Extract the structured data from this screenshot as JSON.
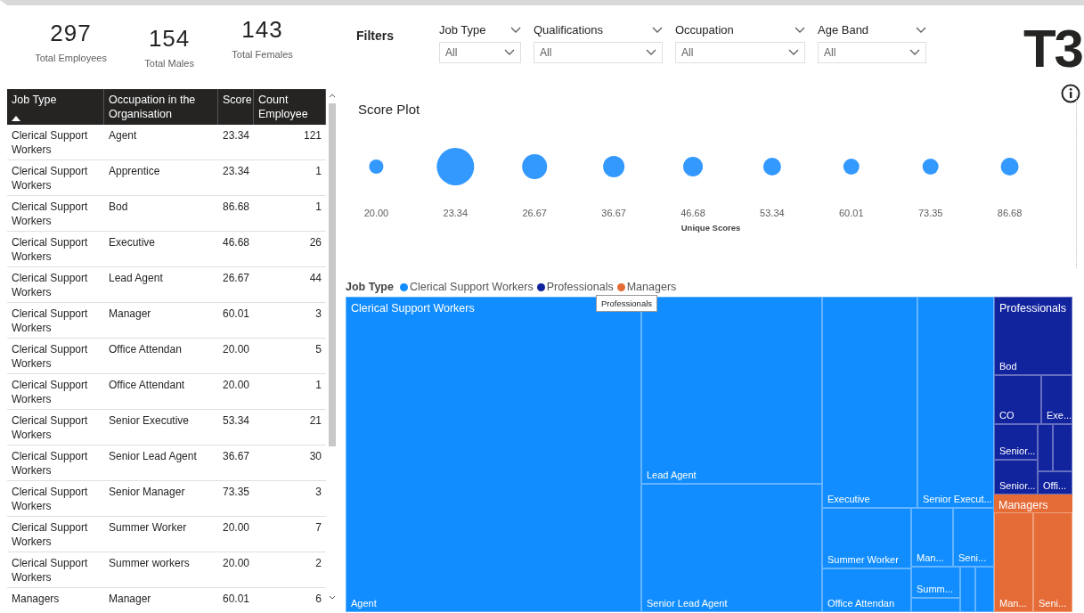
{
  "kpis": [
    {
      "value": "297",
      "label": "Total Employees"
    },
    {
      "value": "154",
      "label": "Total Males"
    },
    {
      "value": "143",
      "label": "Total Females"
    }
  ],
  "table": {
    "columns": [
      {
        "label": "Job Type",
        "sorted": true
      },
      {
        "label": "Occupation in the Organisation",
        "sorted": false
      },
      {
        "label": "Score",
        "sorted": false
      },
      {
        "label": "Count Employee",
        "sorted": false
      }
    ],
    "rows": [
      [
        "Clerical Support Workers",
        "Agent",
        "23.34",
        "121"
      ],
      [
        "Clerical Support Workers",
        "Apprentice",
        "23.34",
        "1"
      ],
      [
        "Clerical Support Workers",
        "Bod",
        "86.68",
        "1"
      ],
      [
        "Clerical Support Workers",
        "Executive",
        "46.68",
        "26"
      ],
      [
        "Clerical Support Workers",
        "Lead Agent",
        "26.67",
        "44"
      ],
      [
        "Clerical Support Workers",
        "Manager",
        "60.01",
        "3"
      ],
      [
        "Clerical Support Workers",
        "Office Attendan",
        "20.00",
        "5"
      ],
      [
        "Clerical Support Workers",
        "Office Attendant",
        "20.00",
        "1"
      ],
      [
        "Clerical Support Workers",
        "Senior Executive",
        "53.34",
        "21"
      ],
      [
        "Clerical Support Workers",
        "Senior Lead Agent",
        "36.67",
        "30"
      ],
      [
        "Clerical Support Workers",
        "Senior Manager",
        "73.35",
        "3"
      ],
      [
        "Clerical Support Workers",
        "Summer Worker",
        "20.00",
        "7"
      ],
      [
        "Clerical Support Workers",
        "Summer workers",
        "20.00",
        "2"
      ],
      [
        "Managers",
        "Manager",
        "60.01",
        "6"
      ]
    ]
  },
  "filters": {
    "title": "Filters",
    "slicers": [
      {
        "label": "Job Type",
        "value": "All"
      },
      {
        "label": "Qualifications",
        "value": "All"
      },
      {
        "label": "Occupation",
        "value": "All"
      },
      {
        "label": "Age Band",
        "value": "All"
      }
    ]
  },
  "logo": "T3",
  "score_plot": {
    "title": "Score Plot",
    "xlabel": "Unique Scores",
    "scores": [
      "20.00",
      "23.34",
      "26.67",
      "36.67",
      "46.68",
      "53.34",
      "60.01",
      "73.35",
      "86.68"
    ]
  },
  "treemap": {
    "legend_title": "Job Type",
    "tooltip": "Professionals",
    "legend": [
      {
        "name": "Clerical Support Workers",
        "color": "#118dff"
      },
      {
        "name": "Professionals",
        "color": "#12239e"
      },
      {
        "name": "Managers",
        "color": "#e66c37"
      }
    ],
    "groups": [
      {
        "name": "Clerical Support Workers",
        "color": "#118dff",
        "tiles": [
          "Agent",
          "Lead Agent",
          "Senior Lead Agent",
          "Executive",
          "Senior Execut...",
          "Summer Worker",
          "Office Attendan",
          "Man...",
          "Seni...",
          "Summ..."
        ]
      },
      {
        "name": "Professionals",
        "color": "#12239e",
        "tiles": [
          "Bod",
          "CO",
          "Exe...",
          "Senior...",
          "Senior...",
          "Offi..."
        ]
      },
      {
        "name": "Managers",
        "color": "#e66c37",
        "tiles": [
          "Man...",
          "Seni..."
        ]
      }
    ]
  }
}
